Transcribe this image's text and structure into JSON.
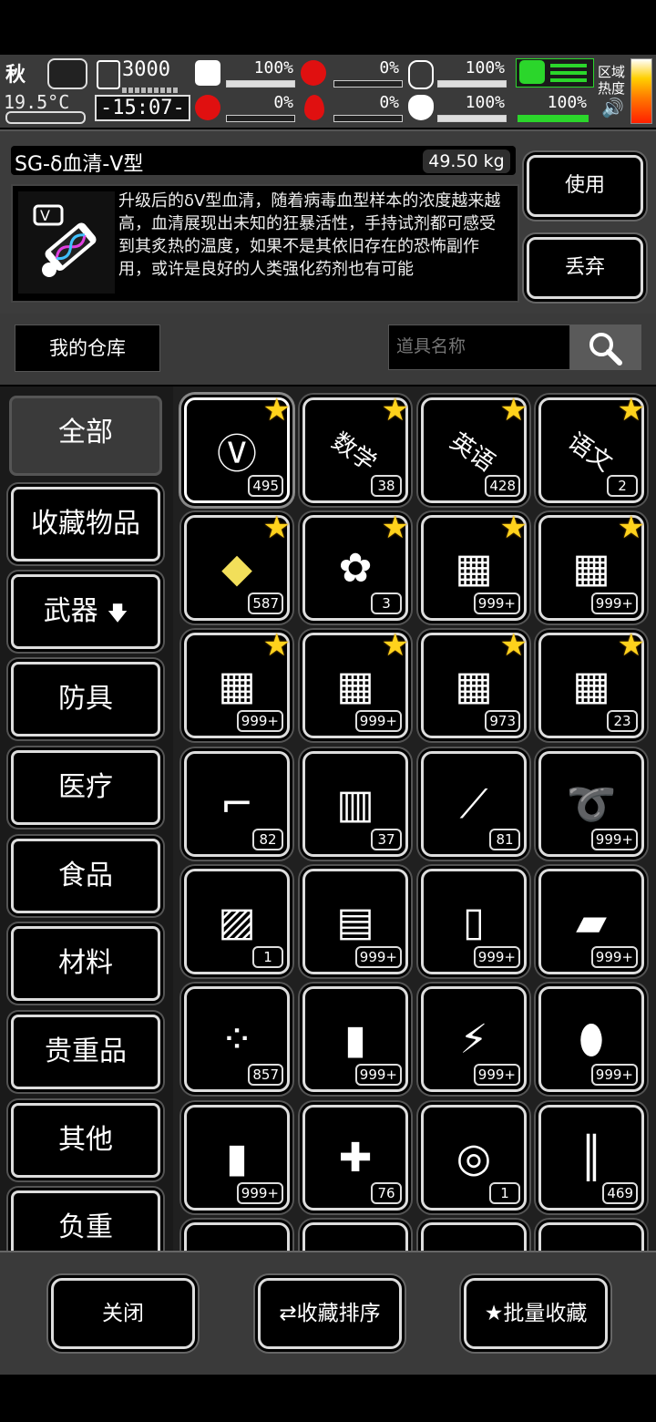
{
  "status": {
    "season": "秋",
    "temperature": "19.5°C",
    "day_value": "3000",
    "time": "-15:07-",
    "medical": "100%",
    "stomach": "0%",
    "drink": "100%",
    "parasite": "0%",
    "blood": "0%",
    "heart": "100%",
    "stamina": "100%",
    "zone_label_1": "区域",
    "zone_label_2": "热度",
    "colors": {
      "accent_green": "#2bd62b",
      "zone_red": "#ff3300",
      "blood_red": "#e01010"
    }
  },
  "detail": {
    "name": "SG-δ血清-V型",
    "weight": "49.50 kg",
    "description": "升级后的δV型血清，随着病毒血型样本的浓度越来越高，血清展现出未知的狂暴活性，手持试剂都可感受到其炙热的温度，如果不是其依旧存在的恐怖副作用，或许是良好的人类强化药剂也有可能",
    "use_label": "使用",
    "discard_label": "丢弃",
    "icon": "serum-vial-icon"
  },
  "warehouse": {
    "tab_label": "我的仓库",
    "search_placeholder": "道具名称"
  },
  "categories": [
    "全部",
    "收藏物品",
    "武器",
    "防具",
    "医疗",
    "食品",
    "材料",
    "贵重品",
    "其他",
    "负重"
  ],
  "items": [
    {
      "icon": "serum-vial-icon",
      "glyph": "Ⓥ",
      "count": "495",
      "star": true
    },
    {
      "icon": "math-book-icon",
      "glyph": "数学",
      "count": "38",
      "star": true
    },
    {
      "icon": "english-book-icon",
      "glyph": "英语",
      "count": "428",
      "star": true
    },
    {
      "icon": "chinese-book-icon",
      "glyph": "语文",
      "count": "2",
      "star": true
    },
    {
      "icon": "gold-crystal-icon",
      "glyph": "◆",
      "count": "587",
      "star": true
    },
    {
      "icon": "flower-bouquet-icon",
      "glyph": "✿",
      "count": "3",
      "star": true
    },
    {
      "icon": "supply-crate-1-icon",
      "glyph": "▦",
      "count": "999+",
      "star": true
    },
    {
      "icon": "supply-crate-2-icon",
      "glyph": "▦",
      "count": "999+",
      "star": true
    },
    {
      "icon": "supply-crate-3-icon",
      "glyph": "▦",
      "count": "999+",
      "star": true
    },
    {
      "icon": "supply-crate-4-icon",
      "glyph": "▦",
      "count": "999+",
      "star": true
    },
    {
      "icon": "supply-crate-5-icon",
      "glyph": "▦",
      "count": "973",
      "star": true
    },
    {
      "icon": "supply-crate-s-icon",
      "glyph": "▦",
      "count": "23",
      "star": true
    },
    {
      "icon": "flare-gun-icon",
      "glyph": "⌐",
      "count": "82",
      "star": false
    },
    {
      "icon": "towel-icon",
      "glyph": "▥",
      "count": "37",
      "star": false
    },
    {
      "icon": "tweezers-icon",
      "glyph": "⟋",
      "count": "81",
      "star": false
    },
    {
      "icon": "rope-icon",
      "glyph": "➰",
      "count": "999+",
      "star": false
    },
    {
      "icon": "magazine-icon",
      "glyph": "▨",
      "count": "1",
      "star": false
    },
    {
      "icon": "wood-planks-icon",
      "glyph": "▤",
      "count": "999+",
      "star": false
    },
    {
      "icon": "cloth-icon",
      "glyph": "▯",
      "count": "999+",
      "star": false
    },
    {
      "icon": "stone-slabs-icon",
      "glyph": "▰",
      "count": "999+",
      "star": false
    },
    {
      "icon": "beads-icon",
      "glyph": "⁘",
      "count": "857",
      "star": false
    },
    {
      "icon": "batteries-icon",
      "glyph": "▮",
      "count": "999+",
      "star": false
    },
    {
      "icon": "battery-pack-icon",
      "glyph": "⚡",
      "count": "999+",
      "star": false
    },
    {
      "icon": "pill-bottle-icon",
      "glyph": "⬮",
      "count": "999+",
      "star": false
    },
    {
      "icon": "liquor-bottle-icon",
      "glyph": "▮",
      "count": "999+",
      "star": false
    },
    {
      "icon": "syringe-icon",
      "glyph": "✚",
      "count": "76",
      "star": false
    },
    {
      "icon": "tire-chain-icon",
      "glyph": "◎",
      "count": "1",
      "star": false
    },
    {
      "icon": "rifle-rounds-icon",
      "glyph": "║",
      "count": "469",
      "star": false
    }
  ],
  "bottom": {
    "close_label": "关闭",
    "sort_label": "收藏排序",
    "batch_label": "批量收藏"
  }
}
